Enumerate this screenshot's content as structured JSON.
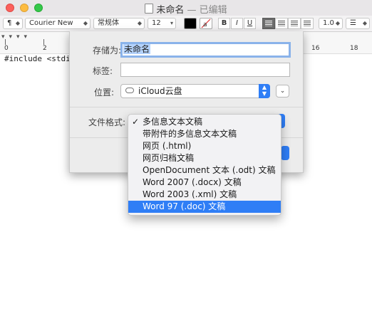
{
  "window": {
    "title": "未命名",
    "edited_suffix": "— 已编辑"
  },
  "toolbar": {
    "paragraph_style": "¶",
    "font_family": "Courier New",
    "font_style": "常规体",
    "font_size": "12",
    "bold": "B",
    "italic": "I",
    "underline": "U",
    "line_spacing": "1.0",
    "list": "☰"
  },
  "ruler": {
    "tab_marks": "▾▾▾▾",
    "labels": [
      "0",
      "2",
      "16",
      "18"
    ]
  },
  "document": {
    "text": "#include <stdi"
  },
  "save_dialog": {
    "save_as_label": "存储为:",
    "save_as_value": "未命名",
    "tags_label": "标签:",
    "tags_value": "",
    "location_label": "位置:",
    "location_value": "iCloud云盘",
    "format_label": "文件格式:"
  },
  "format_menu": {
    "items": [
      {
        "label": "多信息文本文稿",
        "checked": true
      },
      {
        "label": "带附件的多信息文本文稿"
      },
      {
        "label": "网页 (.html)"
      },
      {
        "label": "网页归档文稿"
      },
      {
        "label": "OpenDocument 文本 (.odt) 文稿"
      },
      {
        "label": "Word 2007 (.docx) 文稿"
      },
      {
        "label": "Word 2003 (.xml) 文稿"
      },
      {
        "label": "Word 97 (.doc) 文稿",
        "highlighted": true
      }
    ],
    "checkmark": "✓"
  },
  "colors": {
    "accent": "#2f7ef6",
    "close": "#fc605c",
    "minimize": "#fdbc40",
    "zoom": "#34c84a"
  }
}
